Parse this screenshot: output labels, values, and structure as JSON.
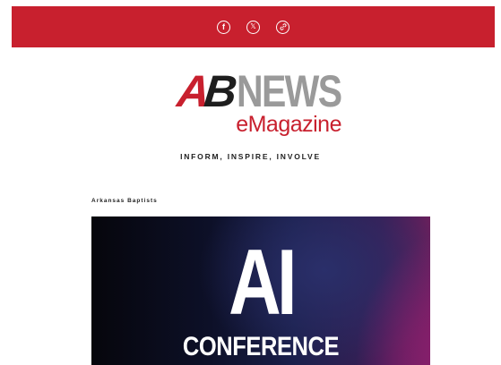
{
  "social": {
    "items": [
      {
        "name": "facebook",
        "icon": "facebook-icon",
        "glyph": "f"
      },
      {
        "name": "x",
        "icon": "x-twitter-icon",
        "glyph": "𝕏"
      },
      {
        "name": "link",
        "icon": "link-icon",
        "glyph": ""
      }
    ]
  },
  "brand": {
    "logo_a": "A",
    "logo_b": "B",
    "logo_news": "NEWS",
    "logo_emagazine": "eMagazine",
    "tagline": "INFORM, INSPIRE, INVOLVE"
  },
  "article": {
    "source": "Arkansas Baptists",
    "hero_title": "AI",
    "hero_subtitle": "CONFERENCE"
  },
  "colors": {
    "brand_red": "#c8202e",
    "logo_gray": "#9a9a9a",
    "logo_dark": "#1e1e1e"
  }
}
